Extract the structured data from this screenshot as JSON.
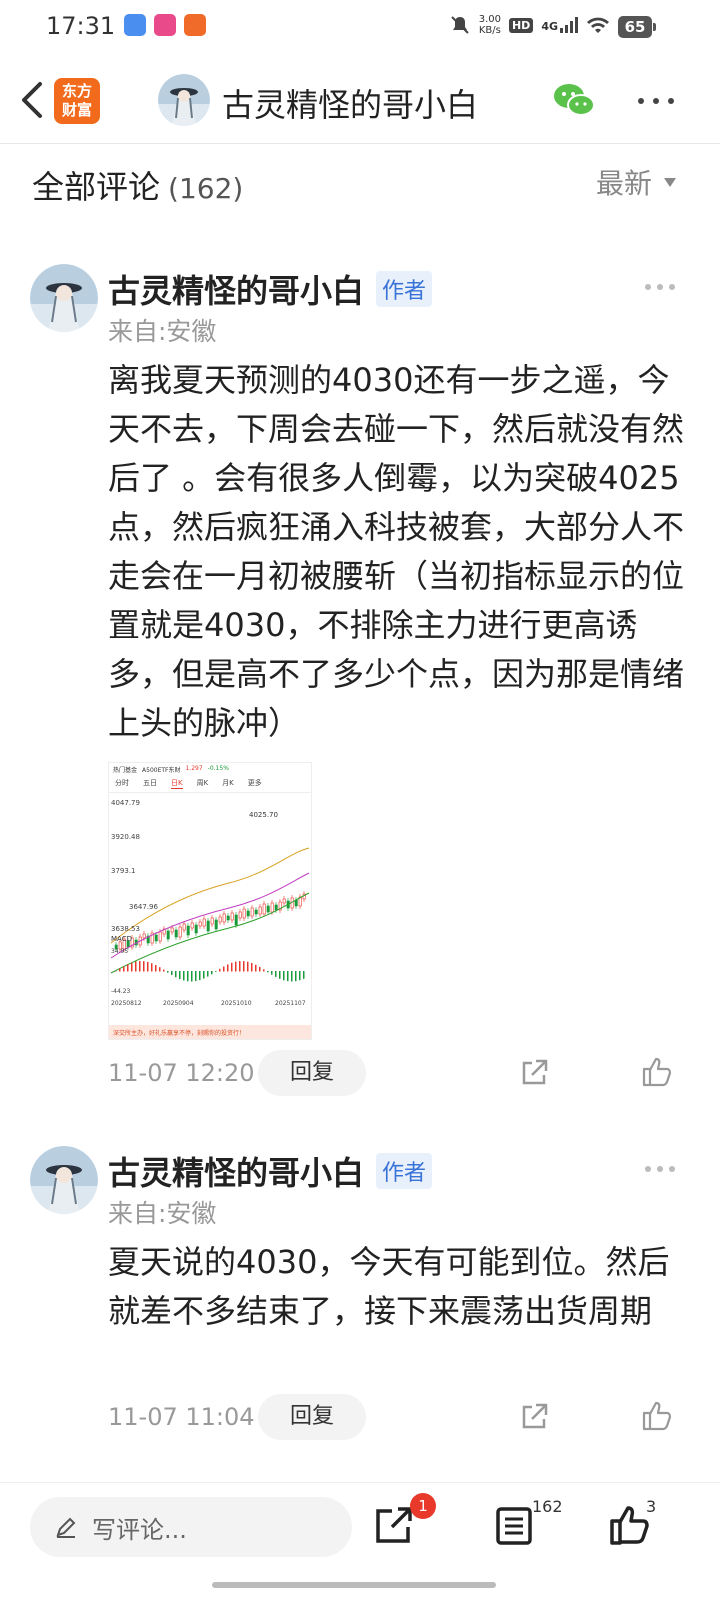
{
  "status_bar": {
    "time": "17:31",
    "net_speed_value": "3.00",
    "net_speed_unit": "KB/s",
    "hd": "HD",
    "signal": "4G",
    "battery": "65"
  },
  "header": {
    "logo_line1": "东方",
    "logo_line2": "财富",
    "title": "古灵精怪的哥小白",
    "accent_color": "#f26a1b"
  },
  "comments_section": {
    "title": "全部评论",
    "count": "(162)",
    "sort_label": "最新"
  },
  "comments": [
    {
      "author": "古灵精怪的哥小白",
      "badge": "作者",
      "location": "来自:安徽",
      "text": "离我夏天预测的4030还有一步之遥，今天不去，下周会去碰一下，然后就没有然后了 。会有很多人倒霉，以为突破4025点，然后疯狂涌入科技被套，大部分人不走会在一月初被腰斩（当初指标显示的位置就是4030，不排除主力进行更高诱多，但是高不了多少个点，因为那是情绪上头的脉冲）",
      "time": "11-07 12:20",
      "reply": "回复",
      "image": {
        "top_label": "热门基金",
        "fund_name": "A500ETF东财",
        "price": "1.297",
        "change": "-0.15%",
        "tabs": [
          "分时",
          "五日",
          "日K",
          "周K",
          "月K",
          "更多"
        ],
        "active_tab": "日K",
        "indicator": "MACD",
        "y_labels": [
          "4047.79",
          "3920.48",
          "3793.1",
          "3647.96",
          "3638.53"
        ],
        "peak_label": "4025.70",
        "macd_labels": [
          "34.95",
          "-44.23"
        ],
        "dates": [
          "20250812",
          "20250904",
          "20251010",
          "20251107"
        ],
        "footer": "深交所主办，好礼乐赢享不停，刻赐你的投资行！"
      }
    },
    {
      "author": "古灵精怪的哥小白",
      "badge": "作者",
      "location": "来自:安徽",
      "text": "夏天说的4030，今天有可能到位。然后就差不多结束了，接下来震荡出货周期",
      "time": "11-07 11:04",
      "reply": "回复"
    }
  ],
  "bottom_bar": {
    "input_placeholder": "写评论...",
    "share_badge": "1",
    "comment_count": "162",
    "like_count": "3"
  }
}
